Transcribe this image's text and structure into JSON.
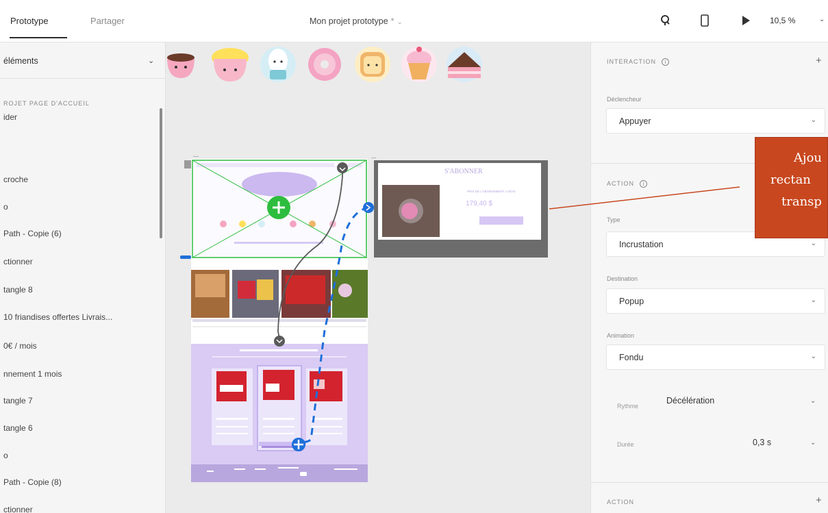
{
  "topbar": {
    "tab_prototype": "Prototype",
    "tab_share": "Partager",
    "doc_title": "Mon projet prototype",
    "doc_modified": "*",
    "zoom": "10,5 %"
  },
  "left_panel": {
    "filter_select": "éléments",
    "section_label": "ROJET PAGE D'ACCUEIL",
    "items": [
      "ider",
      "",
      "croche",
      "o",
      "Path - Copie (6)",
      "ctionner",
      "tangle 8",
      "10 friandises offertes  Livrais...",
      "0€ / mois",
      "nnement 1 mois",
      "tangle 7",
      "tangle 6",
      "o",
      "Path - Copie (8)",
      "ctionner"
    ]
  },
  "right_panel": {
    "interaction_header": "INTERACTION",
    "trigger_label": "Déclencheur",
    "trigger_value": "Appuyer",
    "action_header": "ACTION",
    "type_label": "Type",
    "type_value": "Incrustation",
    "destination_label": "Destination",
    "destination_value": "Popup",
    "animation_label": "Animation",
    "animation_value": "Fondu",
    "rhythm_label": "Rythme",
    "rhythm_value": "Décélération",
    "duration_label": "Durée",
    "duration_value": "0,3 s",
    "action_header_2": "ACTION"
  },
  "callout": {
    "lines": [
      "Ajou",
      "rectan",
      "transp"
    ]
  },
  "canvas": {
    "popup_title": "S'ABONNER",
    "popup_subtitle": "PRIX DE L'ABONNEMENT 1 MOIS",
    "popup_price": "179,40 $",
    "artboard_label": "..."
  },
  "colors": {
    "accent_green": "#2dbd3e",
    "accent_blue": "#1e6fd9",
    "callout_orange": "#c8471e",
    "lavender": "#c9b6ee"
  }
}
